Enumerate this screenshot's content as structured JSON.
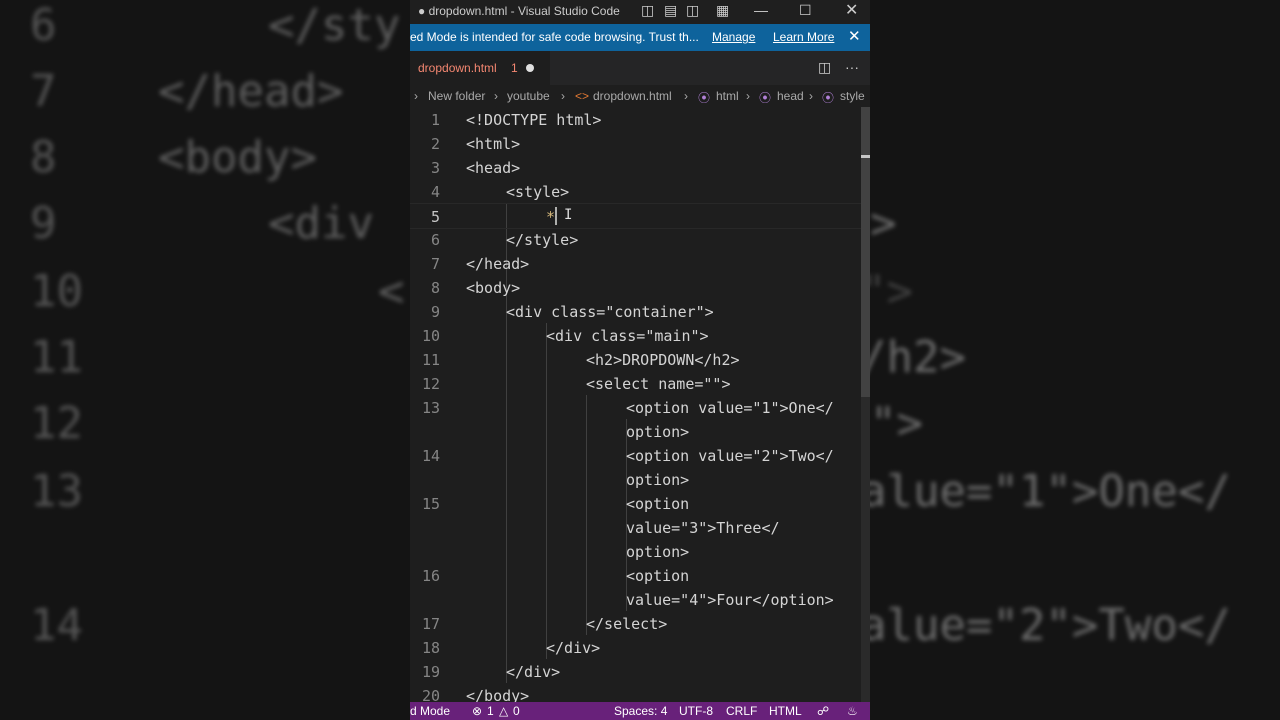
{
  "window": {
    "title": "● dropdown.html - Visual Studio Code"
  },
  "notice": {
    "message": "ed Mode is intended for safe code browsing. Trust th...",
    "manage": "Manage",
    "learn_more": "Learn More"
  },
  "tab": {
    "name": "dropdown.html",
    "problems": "1"
  },
  "breadcrumb": [
    "New folder",
    "youtube",
    "dropdown.html",
    "html",
    "head",
    "style"
  ],
  "editor": {
    "line_numbers": [
      "1",
      "2",
      "3",
      "4",
      "5",
      "6",
      "7",
      "8",
      "9",
      "10",
      "11",
      "12",
      "13",
      "",
      "14",
      "",
      "15",
      "",
      "",
      "16",
      "",
      "17",
      "18",
      "19",
      "20"
    ],
    "lines": [
      "<!DOCTYPE html>",
      "<html>",
      "<head>",
      "<style>",
      "*",
      "</style>",
      "</head>",
      "<body>",
      "<div class=\"container\">",
      "<div class=\"main\">",
      "<h2>DROPDOWN</h2>",
      "<select name=\"\">",
      "<option value=\"1\">One</",
      "option>",
      "<option value=\"2\">Two</",
      "option>",
      "<option",
      "value=\"3\">Three</",
      "option>",
      "<option",
      "value=\"4\">Four</option>",
      "</select>",
      "</div>",
      "</div>",
      "</body>"
    ]
  },
  "statusbar": {
    "mode": "d Mode",
    "errors": "1",
    "warnings": "0",
    "spaces": "Spaces: 4",
    "encoding": "UTF-8",
    "eol": "CRLF",
    "language": "HTML"
  },
  "background": {
    "left_numbers": [
      "6",
      "7",
      "8",
      "9",
      "10",
      "11",
      "12",
      "13",
      "14"
    ],
    "left_code": [
      "</sty",
      "</head>",
      "<body>",
      "<div",
      "<",
      "",
      "",
      "",
      ""
    ],
    "right_code": [
      ">",
      "\">",
      ">",
      "/h2>",
      "\">",
      "alue=\"1\">One</",
      "alue=\"2\">Two</"
    ]
  },
  "colors": {
    "status_bar": "#68217a",
    "notice_bar": "#0e639c",
    "editor_bg": "#1e1e1e"
  }
}
